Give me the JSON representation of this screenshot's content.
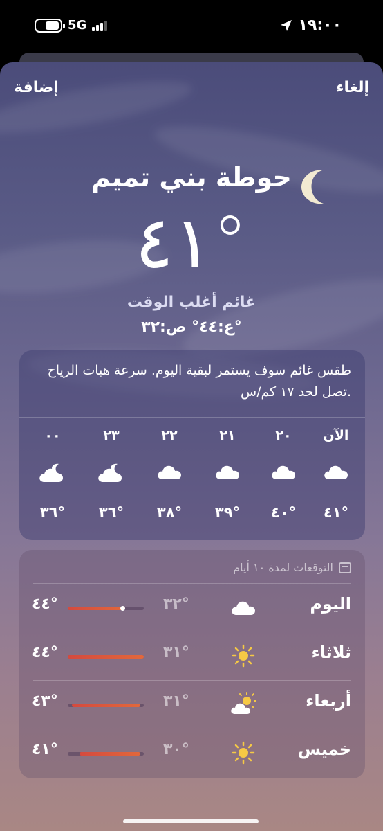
{
  "status_bar": {
    "network": "5G",
    "time": "١٩:٠٠",
    "battery_level": 0.55
  },
  "header": {
    "add_label": "إضافة",
    "cancel_label": "إلغاء"
  },
  "current": {
    "city": "حوطة بني تميم",
    "temperature": "٤١°",
    "condition": "غائم أغلب الوقت",
    "high_low": "ع:٤٤°  ص:٣٢°"
  },
  "hourly": {
    "description": "طقس غائم سوف يستمر لبقية اليوم. سرعة هبات الرياح تصل لحد ١٧ كم/س.",
    "items": [
      {
        "label": "الآن",
        "icon": "cloud-icon",
        "temp": "٤١°"
      },
      {
        "label": "٢٠",
        "icon": "cloud-icon",
        "temp": "٤٠°"
      },
      {
        "label": "٢١",
        "icon": "cloud-icon",
        "temp": "٣٩°"
      },
      {
        "label": "٢٢",
        "icon": "cloud-icon",
        "temp": "٣٨°"
      },
      {
        "label": "٢٣",
        "icon": "cloud-moon-icon",
        "temp": "٣٦°"
      },
      {
        "label": "٠٠",
        "icon": "cloud-moon-icon",
        "temp": "٣٦°"
      }
    ]
  },
  "daily": {
    "header": "التوقعات لمدة ١٠ أيام",
    "days": [
      {
        "name": "اليوم",
        "icon": "cloud-icon",
        "low": "٣٢°",
        "high": "٤٤°",
        "range_start": 0.25,
        "range_end": 1.0,
        "current_marker": 0.27
      },
      {
        "name": "ثلاثاء",
        "icon": "sun-icon",
        "low": "٣١°",
        "high": "٤٤°",
        "range_start": 0.0,
        "range_end": 1.0
      },
      {
        "name": "أربعاء",
        "icon": "sun-cloud-icon",
        "low": "٣١°",
        "high": "٤٣°",
        "range_start": 0.05,
        "range_end": 0.95
      },
      {
        "name": "خميس",
        "icon": "sun-icon",
        "low": "٣٠°",
        "high": "٤١°",
        "range_start": 0.05,
        "range_end": 0.85
      }
    ]
  },
  "colors": {
    "sky_top": "#4b4c7a",
    "sky_bottom": "#a98784",
    "range_hot": "#d44a3e",
    "sun": "#f6c945"
  }
}
